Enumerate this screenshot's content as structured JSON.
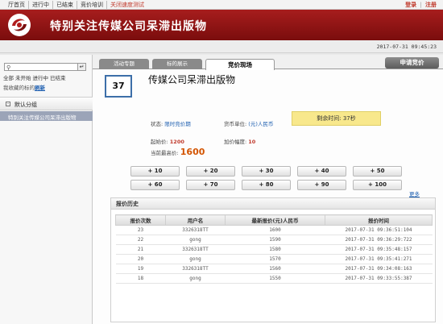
{
  "topnav": {
    "items": [
      "厅首页",
      "进行中",
      "已结束",
      "竞价培训",
      "关闭速度测试"
    ],
    "login": "登录",
    "separator": "|",
    "register": "注册"
  },
  "header": {
    "title": "特别关注传媒公司呆滞出版物"
  },
  "subbar": {
    "time": "2017-07-31 09:45:23"
  },
  "sidebar": {
    "search": {
      "value": "",
      "placeholder": "",
      "button": "↵"
    },
    "filters": [
      "全部",
      "未开始",
      "进行中",
      "已结束"
    ],
    "followed_prefix": "我收藏的标的",
    "followed_link": "刷新",
    "group_toggle": "-",
    "group": "默认分组",
    "group_item": "特别关注传媒公司呆滞出版物"
  },
  "tabs": [
    "活动专题",
    "标的展示",
    "竞价现场"
  ],
  "bid_apply": "申请竞价",
  "item": {
    "number": "37",
    "name": "传媒公司呆滞出版物",
    "status_label": "状态:",
    "status_value": "限时竞价期",
    "currency_label": "货币单位:",
    "currency_value": "(元)人民币",
    "remaining": "剩余时间: 37秒",
    "start_label": "起始价:",
    "start_value": "1200",
    "increment_label": "加价幅度:",
    "increment_value": "10",
    "current_label": "当前最高价:",
    "current_value": "1600"
  },
  "bid_buttons": [
    "+ 10",
    "+ 20",
    "+ 30",
    "+ 40",
    "+ 50",
    "+ 60",
    "+ 70",
    "+ 80",
    "+ 90",
    "+ 100"
  ],
  "more": "更多",
  "history": {
    "title": "报价历史",
    "columns": [
      "报价次数",
      "用户名",
      "最新报价(元)人民币",
      "报价时间"
    ],
    "rows": [
      [
        "23",
        "3326318TT",
        "1600",
        "2017-07-31 09:36:51:104"
      ],
      [
        "22",
        "gong",
        "1590",
        "2017-07-31 09:36:29:722"
      ],
      [
        "21",
        "3326318TT",
        "1580",
        "2017-07-31 09:35:48:157"
      ],
      [
        "20",
        "gong",
        "1570",
        "2017-07-31 09:35:41:271"
      ],
      [
        "19",
        "3326318TT",
        "1560",
        "2017-07-31 09:34:08:163"
      ],
      [
        "18",
        "gong",
        "1550",
        "2017-07-31 09:33:55:387"
      ]
    ]
  },
  "colors": {
    "brand_red": "#8e1515",
    "accent_blue": "#1e5fb0",
    "highlight_yellow": "#f8e88c"
  },
  "icons": {
    "logo": "swirl-logo-icon",
    "search": "search-icon",
    "enter": "enter-icon"
  }
}
